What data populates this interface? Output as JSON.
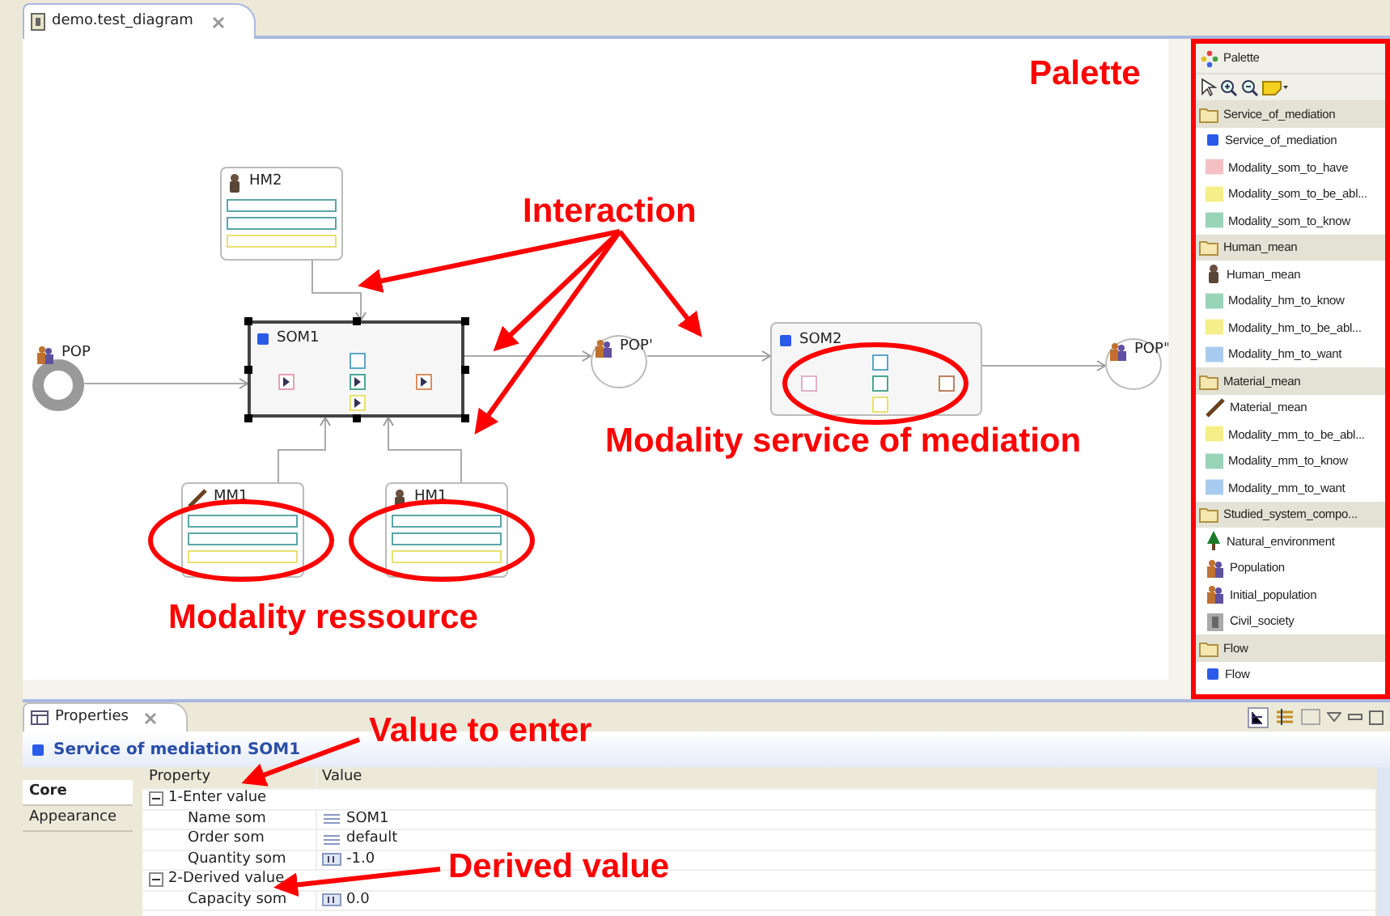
{
  "editor_tab": {
    "label": "demo.test_diagram",
    "selected": true
  },
  "diagram": {
    "nodes": [
      {
        "kind": "population",
        "label": "POP",
        "ring": true
      },
      {
        "kind": "som",
        "label": "SOM1",
        "selected": true,
        "ports": [
          {
            "color": "#e8a0b8",
            "arrow": true
          },
          {
            "color": "#5aa6c8",
            "arrow": false
          },
          {
            "color": "#4aa890",
            "arrow": true
          },
          {
            "color": "#e8e070",
            "arrow": true
          },
          {
            "color": "#d89060",
            "arrow": true
          }
        ]
      },
      {
        "kind": "population",
        "label": "POP'",
        "ring": false
      },
      {
        "kind": "som",
        "label": "SOM2",
        "selected": false,
        "ports": [
          {
            "color": "#e0b0c8",
            "arrow": false
          },
          {
            "color": "#5aa6c8",
            "arrow": false
          },
          {
            "color": "#4aa890",
            "arrow": false
          },
          {
            "color": "#e8e070",
            "arrow": false
          },
          {
            "color": "#c08060",
            "arrow": false
          }
        ]
      },
      {
        "kind": "population",
        "label": "POP\"",
        "ring": false
      },
      {
        "kind": "human_mean",
        "label": "HM2",
        "bars": [
          {
            "color": "#5aa6a8"
          },
          {
            "color": "#5aa6a8"
          },
          {
            "color": "#e8e070"
          }
        ]
      },
      {
        "kind": "material_mean",
        "label": "MM1",
        "bars": [
          {
            "color": "#5aa6a8"
          },
          {
            "color": "#5aa6a8"
          },
          {
            "color": "#e8e070"
          }
        ]
      },
      {
        "kind": "human_mean",
        "label": "HM1",
        "bars": [
          {
            "color": "#5aa6a8"
          },
          {
            "color": "#5aa6a8"
          },
          {
            "color": "#e8e070"
          }
        ]
      }
    ]
  },
  "palette": {
    "title": "Palette",
    "groups": [
      {
        "label": "Service_of_mediation",
        "items": [
          {
            "label": "Service_of_mediation",
            "kind": "som"
          },
          {
            "label": "Modality_som_to_have",
            "kind": "swatch",
            "color": "#f4c0c4"
          },
          {
            "label": "Modality_som_to_be_abl...",
            "kind": "swatch",
            "color": "#f6ee88"
          },
          {
            "label": "Modality_som_to_know",
            "kind": "swatch",
            "color": "#98d4b8"
          }
        ]
      },
      {
        "label": "Human_mean",
        "items": [
          {
            "label": "Human_mean",
            "kind": "human"
          },
          {
            "label": "Modality_hm_to_know",
            "kind": "swatch",
            "color": "#98d4b8"
          },
          {
            "label": "Modality_hm_to_be_abl...",
            "kind": "swatch",
            "color": "#f6ee88"
          },
          {
            "label": "Modality_hm_to_want",
            "kind": "swatch",
            "color": "#a8ccf0"
          }
        ]
      },
      {
        "label": "Material_mean",
        "items": [
          {
            "label": "Material_mean",
            "kind": "material"
          },
          {
            "label": "Modality_mm_to_be_abl...",
            "kind": "swatch",
            "color": "#f6ee88"
          },
          {
            "label": "Modality_mm_to_know",
            "kind": "swatch",
            "color": "#98d4b8"
          },
          {
            "label": "Modality_mm_to_want",
            "kind": "swatch",
            "color": "#a8ccf0"
          }
        ]
      },
      {
        "label": "Studied_system_compo...",
        "items": [
          {
            "label": "Natural_environment",
            "kind": "tree"
          },
          {
            "label": "Population",
            "kind": "people"
          },
          {
            "label": "Initial_population",
            "kind": "people"
          },
          {
            "label": "Civil_society",
            "kind": "building"
          }
        ]
      },
      {
        "label": "Flow",
        "items": [
          {
            "label": "Flow",
            "kind": "som"
          }
        ]
      }
    ]
  },
  "properties": {
    "tab": "Properties",
    "title": "Service of mediation SOM1",
    "side_tabs": [
      {
        "label": "Core",
        "selected": true
      },
      {
        "label": "Appearance",
        "selected": false
      }
    ],
    "columns": [
      "Property",
      "Value"
    ],
    "rows": [
      {
        "property": "1-Enter value",
        "expanded": true,
        "children": [
          {
            "property": "Name som",
            "value": "SOM1",
            "kind": "text"
          },
          {
            "property": "Order som",
            "value": "default",
            "kind": "text"
          },
          {
            "property": "Quantity som",
            "value": "-1.0",
            "kind": "number"
          }
        ]
      },
      {
        "property": "2-Derived value",
        "expanded": true,
        "children": [
          {
            "property": "Capacity som",
            "value": "0.0",
            "kind": "number"
          }
        ]
      }
    ]
  },
  "annotations": [
    "Interaction",
    "Palette",
    "Modality service of mediation",
    "Modality ressource",
    "Value to enter",
    "Derived value"
  ]
}
